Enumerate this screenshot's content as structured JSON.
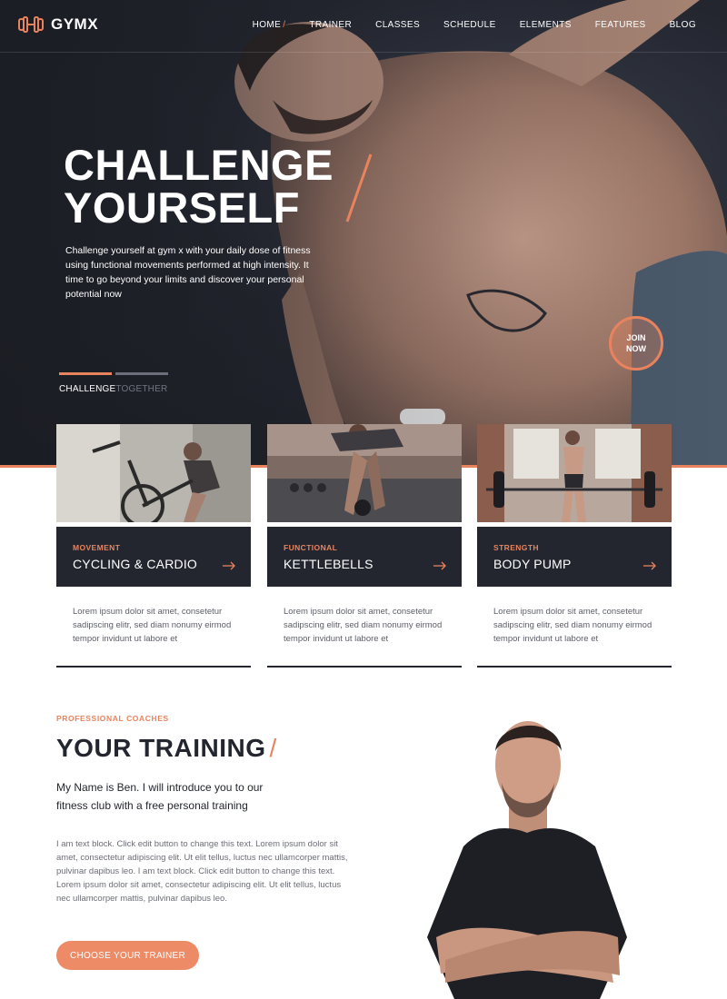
{
  "nav": {
    "logo_text": "GYMX",
    "items": [
      {
        "label": "HOME"
      },
      {
        "label": "TRAINER"
      },
      {
        "label": "CLASSES"
      },
      {
        "label": "SCHEDULE"
      },
      {
        "label": "ELEMENTS"
      },
      {
        "label": "FEATURES"
      },
      {
        "label": "BLOG"
      }
    ],
    "active_slash": "/"
  },
  "hero": {
    "title_line1": "CHALLENGE",
    "title_line2": "YOURSELF",
    "description": "Challenge yourself at gym x with your daily dose of fitness using functional movements performed at high intensity. It time to go beyond your limits and discover your personal potential now",
    "tabs": [
      {
        "label": "CHALLENGE",
        "active": true
      },
      {
        "label": "TOGETHER",
        "active": false
      }
    ],
    "join_button": "JOIN NOW"
  },
  "cards": [
    {
      "category": "MOVEMENT",
      "title": "CYCLING & CARDIO",
      "text": "Lorem ipsum dolor sit amet, consetetur sadipscing elitr, sed diam nonumy eirmod tempor invidunt ut labore et"
    },
    {
      "category": "FUNCTIONAL",
      "title": "KETTLEBELLS",
      "text": "Lorem ipsum dolor sit amet, consetetur sadipscing elitr, sed diam nonumy eirmod tempor invidunt ut labore et"
    },
    {
      "category": "STRENGTH",
      "title": "BODY PUMP",
      "text": "Lorem ipsum dolor sit amet, consetetur sadipscing elitr, sed diam nonumy eirmod tempor invidunt ut labore et"
    }
  ],
  "training": {
    "label": "PROFESSIONAL COACHES",
    "title": "YOUR TRAINING",
    "title_slash": "/",
    "intro": "My Name is Ben. I will introduce you to our fitness club with a free personal training",
    "body": "I am text block. Click edit button to change this text. Lorem ipsum dolor sit amet, consectetur adipiscing elit. Ut elit tellus, luctus nec ullamcorper mattis, pulvinar dapibus leo. I am text block. Click edit button to change this text. Lorem ipsum dolor sit amet, consectetur adipiscing elit. Ut elit tellus, luctus nec ullamcorper mattis, pulvinar dapibus leo.",
    "button": "CHOOSE YOUR TRAINER"
  },
  "colors": {
    "accent": "#e9835e",
    "dark": "#23262f",
    "hero_bg": "#1b1d24"
  }
}
